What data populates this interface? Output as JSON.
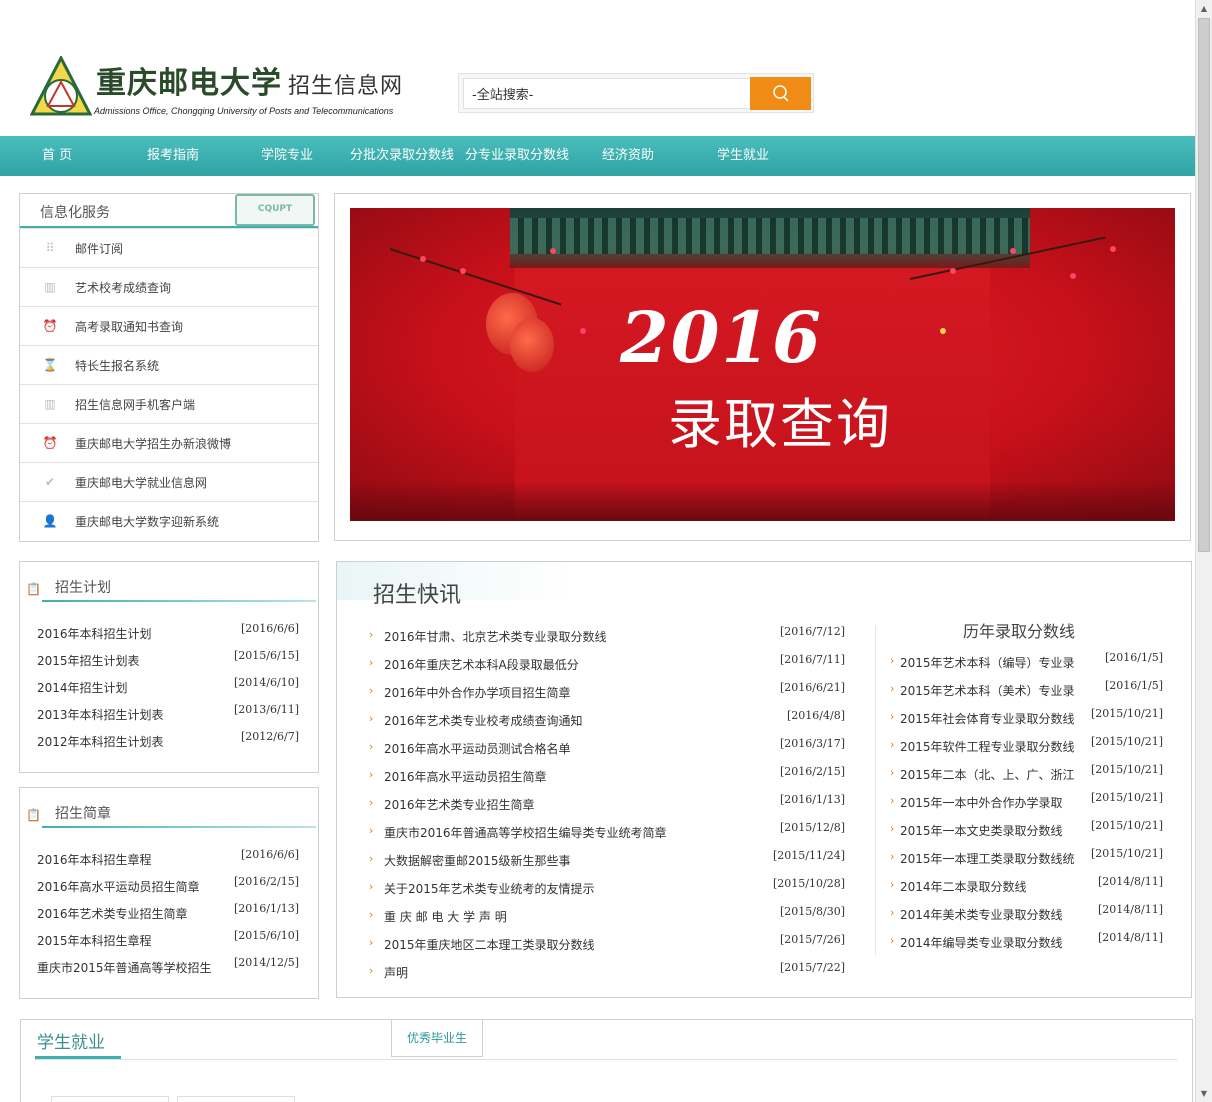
{
  "header": {
    "university_name": "重庆邮电大学",
    "site_name": "招生信息网",
    "english_name": "Admissions Office, Chongqing University of Posts and Telecommunications",
    "search_placeholder": "-全站搜索-"
  },
  "nav": [
    "首 页",
    "报考指南",
    "学院专业",
    "分批次录取分数线",
    "分专业录取分数线",
    "经济资助",
    "学生就业"
  ],
  "services": {
    "title": "信息化服务",
    "stamp": "CQUPT",
    "items": [
      {
        "label": "邮件订阅",
        "icon": "grid-icon"
      },
      {
        "label": "艺术校考成绩查询",
        "icon": "book-icon"
      },
      {
        "label": "高考录取通知书查询",
        "icon": "alarm-icon"
      },
      {
        "label": "特长生报名系统",
        "icon": "hourglass-icon"
      },
      {
        "label": "招生信息网手机客户端",
        "icon": "book-icon"
      },
      {
        "label": "重庆邮电大学招生办新浪微博",
        "icon": "alarm-icon"
      },
      {
        "label": "重庆邮电大学就业信息网",
        "icon": "check-icon"
      },
      {
        "label": "重庆邮电大学数字迎新系统",
        "icon": "user-icon"
      }
    ]
  },
  "banner": {
    "year": "2016",
    "text": "录取查询"
  },
  "plan": {
    "title": "招生计划",
    "items": [
      {
        "title": "2016年本科招生计划",
        "date": "[2016/6/6]"
      },
      {
        "title": "2015年招生计划表",
        "date": "[2015/6/15]"
      },
      {
        "title": "2014年招生计划",
        "date": "[2014/6/10]"
      },
      {
        "title": "2013年本科招生计划表",
        "date": "[2013/6/11]"
      },
      {
        "title": "2012年本科招生计划表",
        "date": "[2012/6/7]"
      }
    ]
  },
  "brochure": {
    "title": "招生简章",
    "items": [
      {
        "title": "2016年本科招生章程",
        "date": "[2016/6/6]"
      },
      {
        "title": "2016年高水平运动员招生简章",
        "date": "[2016/2/15]"
      },
      {
        "title": "2016年艺术类专业招生简章",
        "date": "[2016/1/13]"
      },
      {
        "title": "2015年本科招生章程",
        "date": "[2015/6/10]"
      },
      {
        "title": "重庆市2015年普通高等学校招生",
        "date": "[2014/12/5]"
      }
    ]
  },
  "news": {
    "title": "招生快讯",
    "items": [
      {
        "title": "2016年甘肃、北京艺术类专业录取分数线",
        "date": "[2016/7/12]"
      },
      {
        "title": "2016年重庆艺术本科A段录取最低分",
        "date": "[2016/7/11]"
      },
      {
        "title": "2016年中外合作办学项目招生简章",
        "date": "[2016/6/21]"
      },
      {
        "title": "2016年艺术类专业校考成绩查询通知",
        "date": "[2016/4/8]"
      },
      {
        "title": "2016年高水平运动员测试合格名单",
        "date": "[2016/3/17]"
      },
      {
        "title": "2016年高水平运动员招生简章",
        "date": "[2016/2/15]"
      },
      {
        "title": "2016年艺术类专业招生简章",
        "date": "[2016/1/13]"
      },
      {
        "title": "重庆市2016年普通高等学校招生编导类专业统考简章",
        "date": "[2015/12/8]"
      },
      {
        "title": "大数据解密重邮2015级新生那些事",
        "date": "[2015/11/24]"
      },
      {
        "title": "关于2015年艺术类专业统考的友情提示",
        "date": "[2015/10/28]"
      },
      {
        "title": "重 庆 邮 电 大 学 声 明",
        "date": "[2015/8/30]"
      },
      {
        "title": "2015年重庆地区二本理工类录取分数线",
        "date": "[2015/7/26]"
      },
      {
        "title": "声明",
        "date": "[2015/7/22]"
      }
    ]
  },
  "history": {
    "title": "历年录取分数线",
    "items": [
      {
        "title": "2015年艺术本科（编导）专业录",
        "date": "[2016/1/5]"
      },
      {
        "title": "2015年艺术本科（美术）专业录",
        "date": "[2016/1/5]"
      },
      {
        "title": "2015年社会体育专业录取分数线",
        "date": "[2015/10/21]"
      },
      {
        "title": "2015年软件工程专业录取分数线",
        "date": "[2015/10/21]"
      },
      {
        "title": "2015年二本（北、上、广、浙江",
        "date": "[2015/10/21]"
      },
      {
        "title": "2015年一本中外合作办学录取",
        "date": "[2015/10/21]"
      },
      {
        "title": "2015年一本文史类录取分数线",
        "date": "[2015/10/21]"
      },
      {
        "title": "2015年一本理工类录取分数线统",
        "date": "[2015/10/21]"
      },
      {
        "title": "2014年二本录取分数线",
        "date": "[2014/8/11]"
      },
      {
        "title": "2014年美术类专业录取分数线",
        "date": "[2014/8/11]"
      },
      {
        "title": "2014年编导类专业录取分数线",
        "date": "[2014/8/11]"
      }
    ]
  },
  "employment": {
    "title": "学生就业",
    "tab": "优秀毕业生"
  },
  "colors": {
    "nav": "#3db0b0",
    "search_button": "#f08b16",
    "accent_arrow": "#e07b10"
  }
}
